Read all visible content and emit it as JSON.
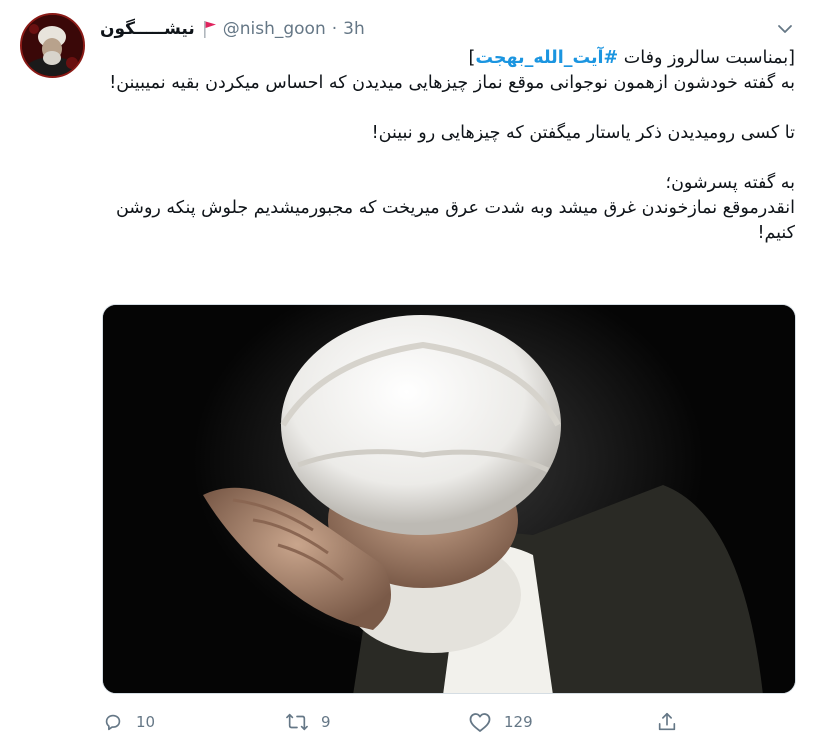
{
  "tweet": {
    "display_name": "نیشـــــگون",
    "handle": "@nish_goon",
    "separator": "·",
    "time": "3h",
    "text": {
      "line1_prefix": "[بمناسبت سالروز وفات",
      "hashtag": "#آیت_الله_بهجت",
      "line1_suffix": "]",
      "para1": "به گفته خودشون ازهمون نوجوانی موقع نماز چیزهایی میدیدن که احساس میکردن بقیه نمیبینن!",
      "para2": "تا کسی رومیدیدن ذکر  یاستار میگفتن که چیزهایی رو نبینن!",
      "para3_a": "به گفته پسرشون؛",
      "para3_b": "انقدرموقع نمازخوندن غرق میشد وبه شدت عرق میریخت که مجبورمیشدیم جلوش پنکه روشن کنیم!"
    },
    "actions": {
      "reply_count": "10",
      "retweet_count": "9",
      "like_count": "129"
    }
  },
  "colors": {
    "accent": "#1b95e0",
    "muted": "#657786",
    "flag": "#e0245e"
  },
  "icons": {
    "flag": "red-flag-icon",
    "caret": "chevron-down-icon",
    "reply": "reply-icon",
    "retweet": "retweet-icon",
    "like": "heart-icon",
    "share": "share-icon"
  }
}
